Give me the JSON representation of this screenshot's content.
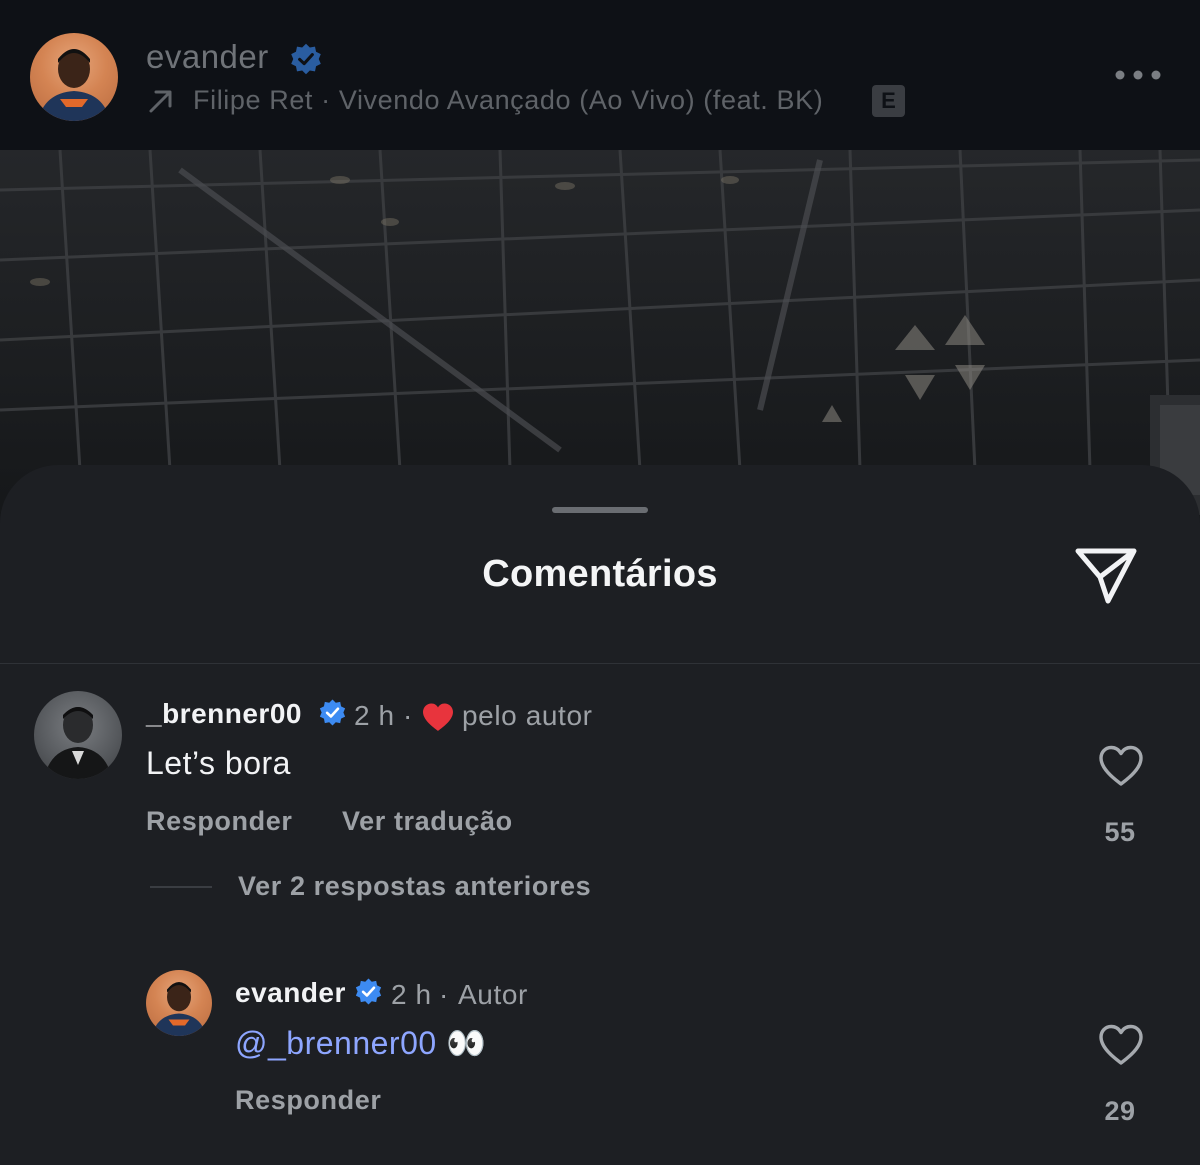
{
  "post": {
    "username": "evander",
    "music": "Filipe Ret · Vivendo Avançado (Ao Vivo) (feat. BK)",
    "explicit_badge": "E",
    "icons": {
      "verified": "verified-badge-icon",
      "music": "arrow-up-right-icon",
      "more": "more-dots-icon"
    }
  },
  "comments_sheet": {
    "title": "Comentários",
    "share_icon": "paper-plane-icon",
    "comments": [
      {
        "username": "_brenner00",
        "time": "2 h",
        "separator": "·",
        "liked_by_author": "pelo autor",
        "text": "Let’s bora",
        "reply_label": "Responder",
        "translate_label": "Ver tradução",
        "likes": "55",
        "view_replies": "Ver 2 respostas anteriores"
      },
      {
        "username": "evander",
        "time": "2 h",
        "separator": "·",
        "author_label": "Autor",
        "mention": "@_brenner00",
        "text_suffix": "👀",
        "reply_label": "Responder",
        "likes": "29"
      }
    ]
  },
  "colors": {
    "background": "#0e1116",
    "sheet": "#1d1f23",
    "verified": "#3d8bf2",
    "heart": "#e8343d",
    "mention": "#8ea6ff",
    "muted_text": "#9da1a6"
  }
}
